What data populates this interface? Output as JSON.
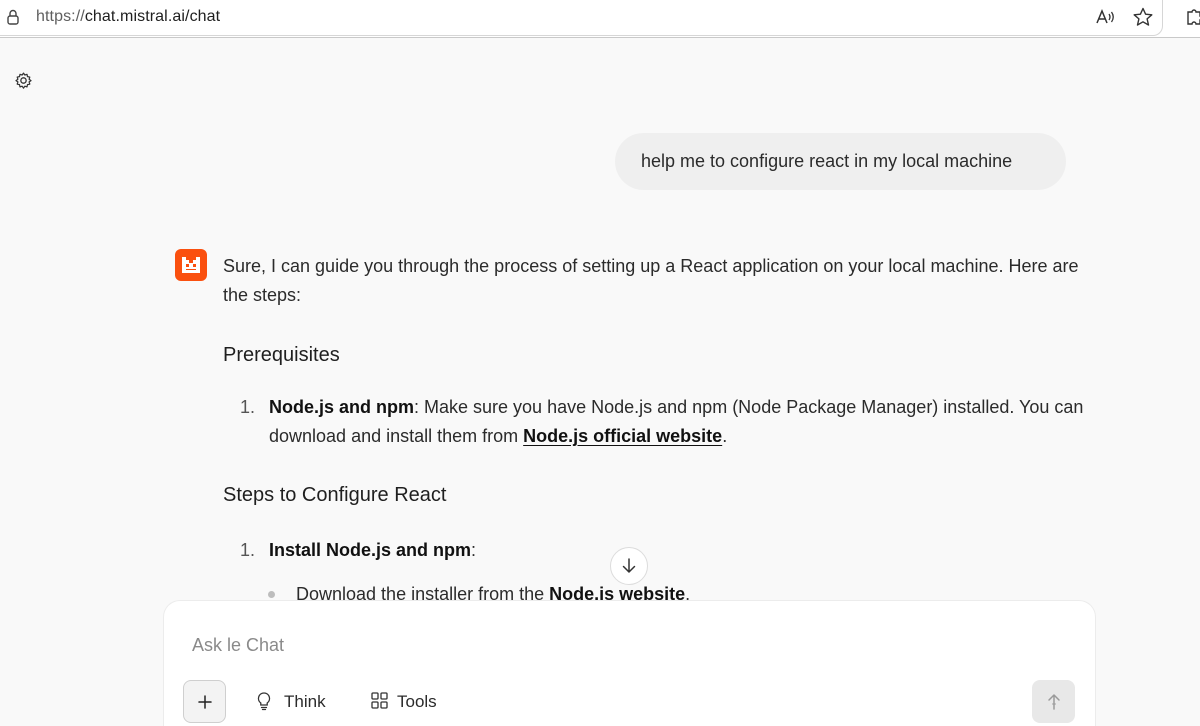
{
  "browser": {
    "url_protocol": "https://",
    "url_host_path": "chat.mistral.ai/chat",
    "icons": [
      "lock-icon",
      "read-aloud-icon",
      "favorite-star-icon",
      "extensions-icon"
    ]
  },
  "sidebar": {
    "settings_icon": "gear-icon"
  },
  "conversation": {
    "user_message": "help me to configure react in my local machine",
    "assistant": {
      "intro": "Sure, I can guide you through the process of setting up a React application on your local machine. Here are the steps:",
      "section_prereq": "Prerequisites",
      "prereq_item": {
        "number": "1.",
        "bold": "Node.js and npm",
        "text": ": Make sure you have Node.js and npm (Node Package Manager) installed. You can download and install them from ",
        "link": "Node.js official website",
        "end": "."
      },
      "section_steps": "Steps to Configure React",
      "step_item": {
        "number": "1.",
        "bold": "Install Node.js and npm",
        "end": ":"
      },
      "bullet": {
        "text": "Download the installer from the ",
        "bold": "Node.js website",
        "end": "."
      }
    }
  },
  "composer": {
    "placeholder": "Ask le Chat",
    "add_label": "+",
    "think_label": "Think",
    "tools_label": "Tools"
  },
  "colors": {
    "brand": "#fa500f",
    "background": "#f9f9f9",
    "bubble": "#efefef"
  }
}
